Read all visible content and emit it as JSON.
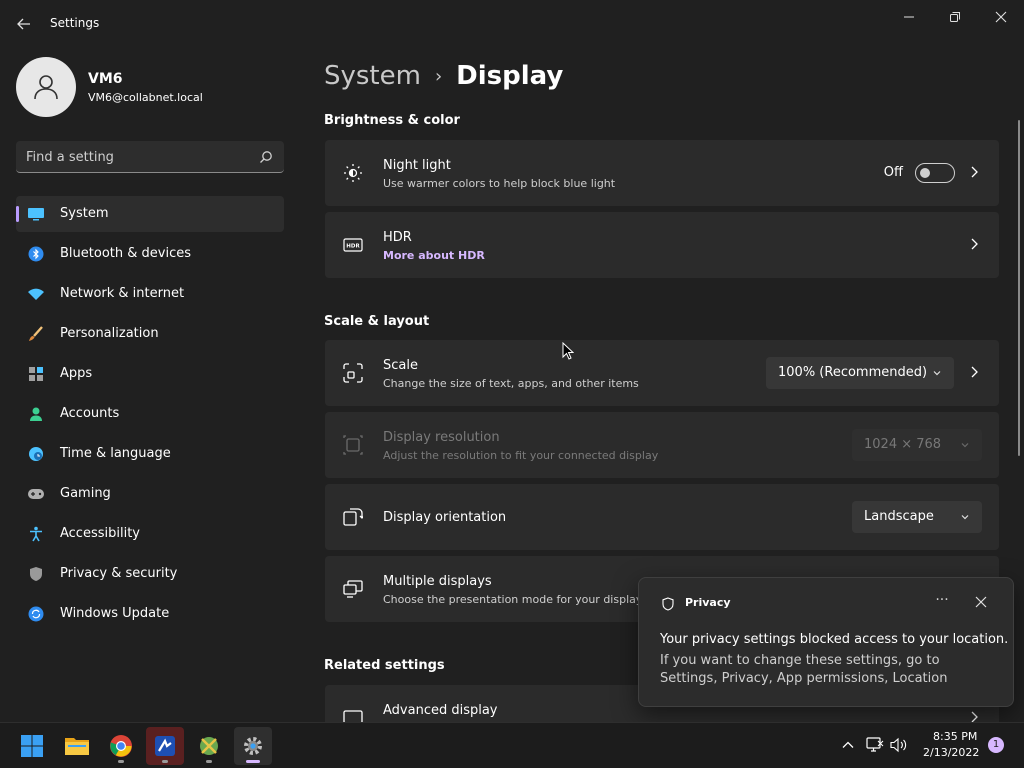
{
  "window": {
    "title": "Settings",
    "controls": {
      "minimize": "minimize",
      "maximize": "maximize",
      "close": "close"
    }
  },
  "profile": {
    "name": "VM6",
    "email": "VM6@collabnet.local"
  },
  "search": {
    "placeholder": "Find a setting"
  },
  "sidebar": {
    "items": [
      {
        "label": "System",
        "icon": "monitor-icon",
        "active": true
      },
      {
        "label": "Bluetooth & devices",
        "icon": "bluetooth-icon"
      },
      {
        "label": "Network & internet",
        "icon": "wifi-icon"
      },
      {
        "label": "Personalization",
        "icon": "brush-icon"
      },
      {
        "label": "Apps",
        "icon": "apps-icon"
      },
      {
        "label": "Accounts",
        "icon": "person-icon"
      },
      {
        "label": "Time & language",
        "icon": "clock-globe-icon"
      },
      {
        "label": "Gaming",
        "icon": "gamepad-icon"
      },
      {
        "label": "Accessibility",
        "icon": "accessibility-icon"
      },
      {
        "label": "Privacy & security",
        "icon": "shield-icon"
      },
      {
        "label": "Windows Update",
        "icon": "refresh-icon"
      }
    ]
  },
  "breadcrumb": {
    "parent": "System",
    "separator": "›",
    "current": "Display"
  },
  "sections": {
    "brightness": "Brightness & color",
    "scale_layout": "Scale & layout",
    "related": "Related settings"
  },
  "cards": {
    "night_light": {
      "title": "Night light",
      "subtitle": "Use warmer colors to help block blue light",
      "state_label": "Off",
      "on": false
    },
    "hdr": {
      "title": "HDR",
      "link": "More about HDR"
    },
    "scale": {
      "title": "Scale",
      "subtitle": "Change the size of text, apps, and other items",
      "value": "100% (Recommended)"
    },
    "resolution": {
      "title": "Display resolution",
      "subtitle": "Adjust the resolution to fit your connected display",
      "value": "1024 × 768",
      "disabled": true
    },
    "orientation": {
      "title": "Display orientation",
      "value": "Landscape"
    },
    "multiple": {
      "title": "Multiple displays",
      "subtitle": "Choose the presentation mode for your displays"
    },
    "advanced": {
      "title": "Advanced display"
    }
  },
  "toast": {
    "app": "Privacy",
    "more": "···",
    "title": "Your privacy settings blocked access to your location.",
    "body": "If you want to change these settings, go to Settings, Privacy, App permissions, Location"
  },
  "taskbar": {
    "apps": [
      "start-icon",
      "file-explorer-icon",
      "chrome-icon",
      "app-icon",
      "app-icon",
      "settings-icon"
    ],
    "time": "8:35 PM",
    "date": "2/13/2022",
    "notifications": "1"
  },
  "colors": {
    "accent": "#d7b8ff",
    "background": "#202020",
    "card": "#2b2b2b"
  }
}
